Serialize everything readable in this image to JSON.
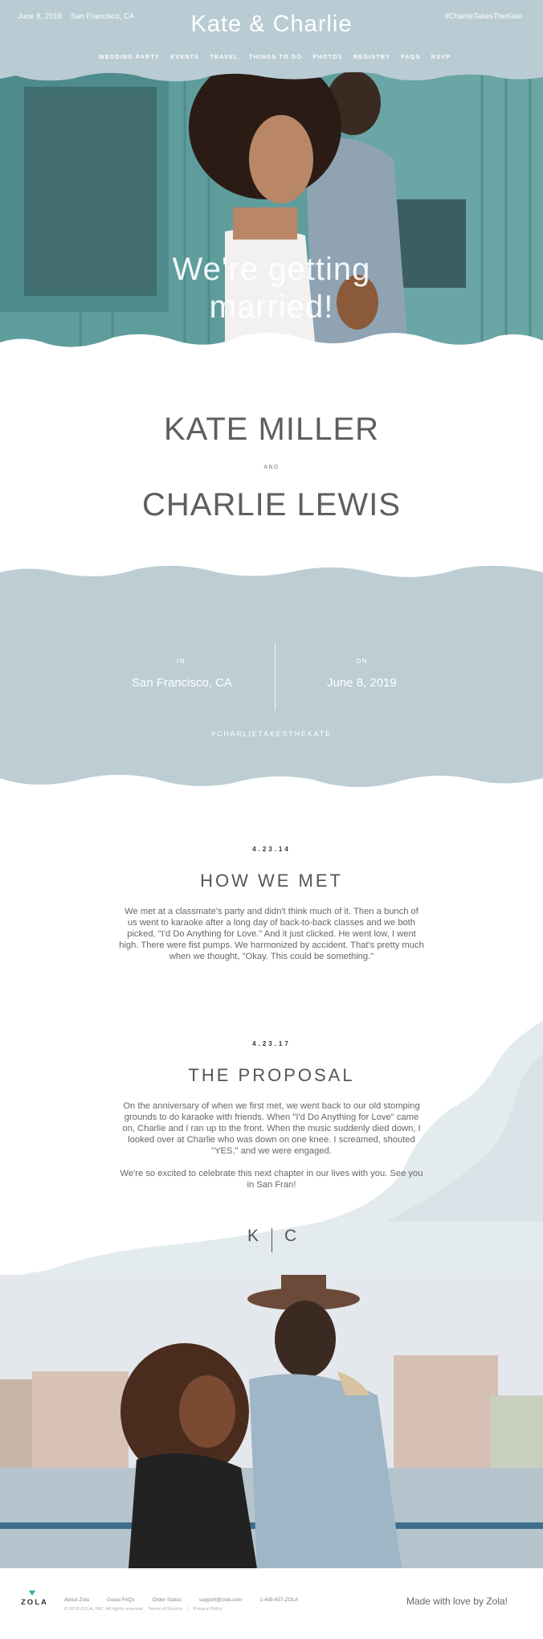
{
  "header": {
    "date": "June 8, 2019",
    "city": "San Francisco, CA",
    "title": "Kate & Charlie",
    "hashtag": "#CharlieTakesTheKate",
    "nav": [
      "WEDDING PARTY",
      "EVENTS",
      "TRAVEL",
      "THINGS TO DO",
      "PHOTOS",
      "REGISTRY",
      "FAQS",
      "RSVP"
    ]
  },
  "hero": {
    "headline_line1": "We're getting",
    "headline_line2": "married!"
  },
  "couple": {
    "name1": "KATE MILLER",
    "and": "AND",
    "name2": "CHARLIE LEWIS"
  },
  "details": {
    "in_label": "IN",
    "city": "San Francisco, CA",
    "on_label": "ON",
    "date": "June 8, 2019",
    "hashtag": "#CHARLIETAKESTHEKATE"
  },
  "how_we_met": {
    "date": "4.23.14",
    "title": "HOW WE MET",
    "text": "We met at a classmate's party and didn't think much of it. Then a bunch of us went to karaoke after a long day of back-to-back classes and we both picked, \"I'd Do Anything for Love.\" And it just clicked. He went low, I went high. There were fist pumps. We harmonized by accident. That's pretty much when we thought, \"Okay. This could be something.\""
  },
  "proposal": {
    "date": "4.23.17",
    "title": "THE PROPOSAL",
    "text": "On the anniversary of when we first met, we went back to our old stomping grounds to do karaoke with friends. When \"I'd Do Anything for Love\" came on, Charlie and I ran up to the front. When the music suddenly died down, I looked over at Charlie who was down on one knee. I screamed, shouted \"YES,\" and we were engaged.",
    "text2": "We're so excited to celebrate this next chapter in our lives with you. See you in San Fran!"
  },
  "monogram": {
    "left": "K",
    "right": "C"
  },
  "footer": {
    "brand": "ZOLA",
    "links": [
      "About Zola",
      "Guest FAQs",
      "Order Status",
      "support@zola.com",
      "1-408-657-ZOLA"
    ],
    "copyright": "© 2018 ZOLA, INC. All rights reserved",
    "terms": "Terms of Service",
    "privacy": "Privacy Policy",
    "made_with_love": "Made with love by Zola!"
  },
  "colors": {
    "header_blue": "#b9ccd3",
    "band_blue": "#bccdd4",
    "wall_teal": "#5e9c9c"
  }
}
